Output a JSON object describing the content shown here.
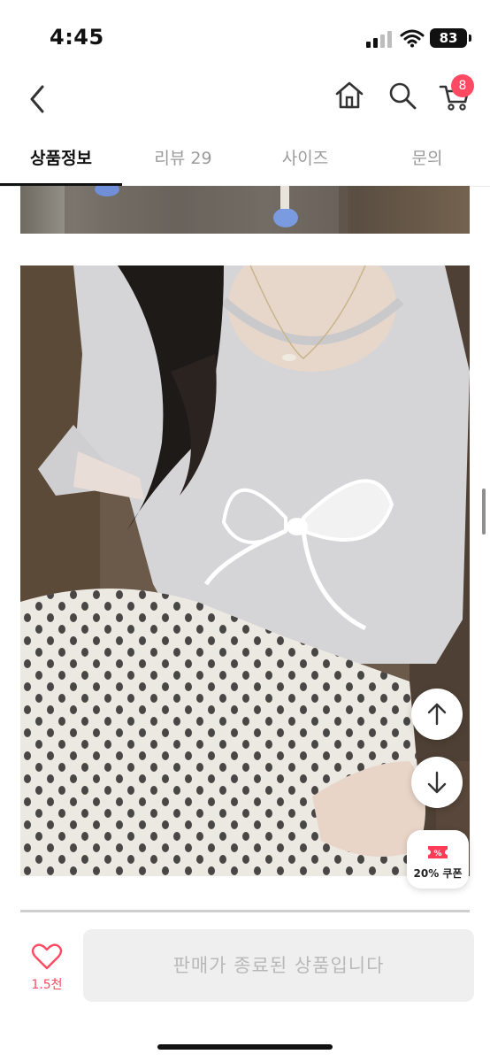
{
  "status_bar": {
    "time": "4:45",
    "battery": "83"
  },
  "header": {
    "cart_count": "8"
  },
  "tabs": [
    {
      "label": "상품정보",
      "active": true
    },
    {
      "label": "리뷰 29",
      "active": false
    },
    {
      "label": "사이즈",
      "active": false
    },
    {
      "label": "문의",
      "active": false
    }
  ],
  "floating": {
    "coupon_label": "20% 쿠폰"
  },
  "bottom_bar": {
    "like_count": "1.5천",
    "purchase_label": "판매가 종료된 상품입니다"
  },
  "colors": {
    "accent": "#ff4a62",
    "disabled_bg": "#efefef",
    "disabled_text": "#b8b8b8"
  },
  "icons": [
    "back-icon",
    "home-icon",
    "search-icon",
    "cart-icon",
    "arrow-up-icon",
    "arrow-down-icon",
    "coupon-icon",
    "heart-icon"
  ]
}
